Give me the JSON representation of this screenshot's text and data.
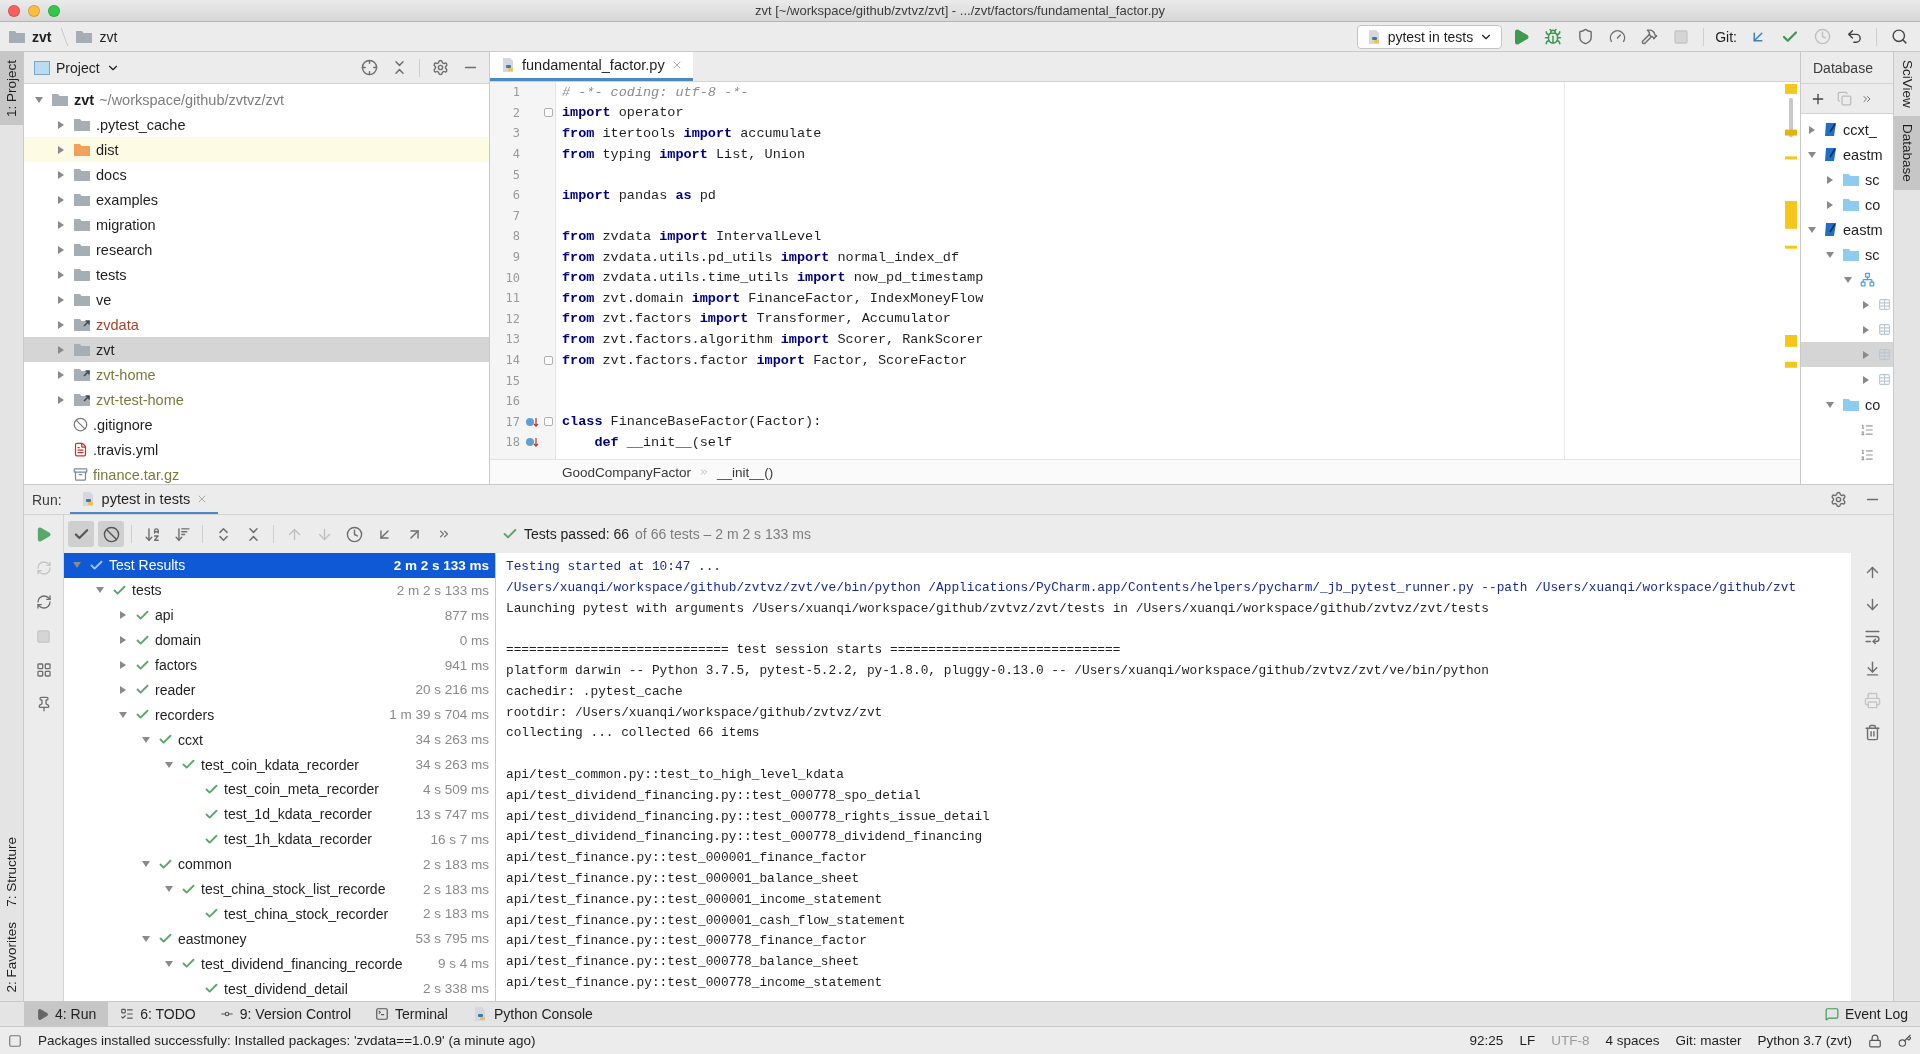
{
  "window": {
    "title": "zvt [~/workspace/github/zvtvz/zvt] - .../zvt/factors/fundamental_factor.py"
  },
  "breadcrumb": [
    "zvt",
    "zvt"
  ],
  "toolbar": {
    "run_config": "pytest in tests",
    "git_label": "Git:"
  },
  "left_strip": [
    {
      "label": "1: Project",
      "selected": true
    },
    {
      "label": "7: Structure",
      "selected": false
    },
    {
      "label": "2: Favorites",
      "selected": false
    }
  ],
  "right_strip": [
    {
      "label": "SciView",
      "selected": false
    },
    {
      "label": "Database",
      "selected": true
    }
  ],
  "project": {
    "header": "Project",
    "root": {
      "name": "zvt",
      "path": "~/workspace/github/zvtvz/zvt",
      "expanded": true
    },
    "items": [
      {
        "name": ".pytest_cache",
        "kind": "folder",
        "color": "#1f1f1f",
        "selected": false
      },
      {
        "name": "dist",
        "kind": "excluded",
        "color": "#1f1f1f",
        "selected": false
      },
      {
        "name": "docs",
        "kind": "folder",
        "color": "#1f1f1f",
        "selected": false
      },
      {
        "name": "examples",
        "kind": "folder",
        "color": "#1f1f1f",
        "selected": false
      },
      {
        "name": "migration",
        "kind": "folder",
        "color": "#1f1f1f",
        "selected": false
      },
      {
        "name": "research",
        "kind": "folder",
        "color": "#1f1f1f",
        "selected": false
      },
      {
        "name": "tests",
        "kind": "folder",
        "color": "#1f1f1f",
        "selected": false
      },
      {
        "name": "ve",
        "kind": "folder",
        "color": "#1f1f1f",
        "selected": false
      },
      {
        "name": "zvdata",
        "kind": "link",
        "color": "#a6442a",
        "selected": false
      },
      {
        "name": "zvt",
        "kind": "folder",
        "color": "#1f1f1f",
        "selected": true
      },
      {
        "name": "zvt-home",
        "kind": "link",
        "color": "#7b7a3c",
        "selected": false
      },
      {
        "name": "zvt-test-home",
        "kind": "link",
        "color": "#7b7a3c",
        "selected": false
      },
      {
        "name": ".gitignore",
        "kind": "ignore-file",
        "color": "#1f1f1f",
        "selected": false
      },
      {
        "name": ".travis.yml",
        "kind": "yaml",
        "color": "#1f1f1f",
        "selected": false
      },
      {
        "name": "finance.tar.gz",
        "kind": "archive",
        "color": "#7b7a3c",
        "selected": false
      }
    ]
  },
  "editor": {
    "tab": "fundamental_factor.py",
    "lines": [
      {
        "n": "1",
        "kind": "comment",
        "text": "# -*- coding: utf-8 -*-",
        "fold": false,
        "overridden": false
      },
      {
        "n": "2",
        "kind": "code",
        "text": "**import** operator",
        "fold": true,
        "overridden": false
      },
      {
        "n": "3",
        "kind": "code",
        "text": "**from** itertools **import** accumulate",
        "fold": false,
        "overridden": false
      },
      {
        "n": "4",
        "kind": "code",
        "text": "**from** typing **import** List, Union",
        "fold": false,
        "overridden": false
      },
      {
        "n": "5",
        "kind": "blank",
        "fold": false,
        "overridden": false
      },
      {
        "n": "6",
        "kind": "code",
        "text": "**import** pandas **as** pd",
        "fold": false,
        "overridden": false
      },
      {
        "n": "7",
        "kind": "blank",
        "fold": false,
        "overridden": false
      },
      {
        "n": "8",
        "kind": "code",
        "text": "**from** zvdata **import** IntervalLevel",
        "fold": false,
        "overridden": false
      },
      {
        "n": "9",
        "kind": "code",
        "text": "**from** zvdata.utils.pd_utils **import** normal_index_df",
        "fold": false,
        "overridden": false
      },
      {
        "n": "10",
        "kind": "code",
        "text": "**from** zvdata.utils.time_utils **import** now_pd_timestamp",
        "fold": false,
        "overridden": false
      },
      {
        "n": "11",
        "kind": "code",
        "text": "**from** zvt.domain **import** FinanceFactor, IndexMoneyFlow",
        "fold": false,
        "overridden": false
      },
      {
        "n": "12",
        "kind": "code",
        "text": "**from** zvt.factors **import** Transformer, Accumulator",
        "fold": false,
        "overridden": false
      },
      {
        "n": "13",
        "kind": "code",
        "text": "**from** zvt.factors.algorithm **import** Scorer, RankScorer",
        "fold": false,
        "overridden": false
      },
      {
        "n": "14",
        "kind": "code",
        "text": "**from** zvt.factors.factor **import** Factor, ScoreFactor",
        "fold": true,
        "overridden": false
      },
      {
        "n": "15",
        "kind": "blank",
        "fold": false,
        "overridden": false
      },
      {
        "n": "16",
        "kind": "blank",
        "fold": false,
        "overridden": false
      },
      {
        "n": "17",
        "kind": "code",
        "text": "**class** FinanceBaseFactor(Factor):",
        "fold": true,
        "overridden": true
      },
      {
        "n": "18",
        "kind": "code",
        "text": "    **def** __init__(self",
        "fold": false,
        "overridden": true
      }
    ],
    "breadcrumb": [
      "GoodCompanyFactor",
      "__init__()"
    ]
  },
  "database": {
    "header": "Database",
    "items": [
      {
        "name": "ccxt_",
        "kind": "database",
        "expanded": false,
        "selected": false
      },
      {
        "name": "eastm",
        "kind": "database",
        "expanded": true,
        "selected": false,
        "children": [
          {
            "name": "sc",
            "kind": "folder",
            "expanded": false,
            "selected": false
          },
          {
            "name": "co",
            "kind": "folder",
            "expanded": false,
            "selected": false
          }
        ]
      },
      {
        "name": "eastm",
        "kind": "database",
        "expanded": true,
        "selected": false,
        "children": [
          {
            "name": "sc",
            "kind": "folder",
            "expanded": true,
            "selected": false,
            "children": [
              {
                "kind": "schema",
                "expanded": true,
                "selected": false,
                "children": [
                  {
                    "kind": "table",
                    "expanded": false,
                    "selected": false
                  },
                  {
                    "kind": "table",
                    "expanded": false,
                    "selected": false
                  },
                  {
                    "kind": "table",
                    "expanded": false,
                    "selected": true
                  },
                  {
                    "kind": "table",
                    "expanded": false,
                    "selected": false
                  }
                ]
              }
            ]
          },
          {
            "name": "co",
            "kind": "folder",
            "expanded": true,
            "selected": false,
            "children": [
              {
                "kind": "index",
                "selected": false
              },
              {
                "kind": "index",
                "selected": false
              }
            ]
          }
        ]
      }
    ]
  },
  "run": {
    "label": "Run:",
    "tab": "pytest in tests",
    "summary": "Tests passed: 66",
    "summary_detail": "of 66 tests – 2 m 2 s 133 ms",
    "toggles": [
      {
        "kind": "show-passed",
        "on": true
      },
      {
        "kind": "show-ignored",
        "on": true
      }
    ],
    "tests": [
      {
        "name": "Test Results",
        "time": "2 m 2 s 133 ms",
        "passed": true,
        "expanded": true,
        "selected": true,
        "children": [
          {
            "name": "tests",
            "time": "2 m 2 s 133 ms",
            "passed": true,
            "expanded": true,
            "selected": false,
            "children": [
              {
                "name": "api",
                "time": "877 ms",
                "passed": true,
                "expanded": false,
                "selected": false
              },
              {
                "name": "domain",
                "time": "0 ms",
                "passed": true,
                "expanded": false,
                "selected": false
              },
              {
                "name": "factors",
                "time": "941 ms",
                "passed": true,
                "expanded": false,
                "selected": false
              },
              {
                "name": "reader",
                "time": "20 s 216 ms",
                "passed": true,
                "expanded": false,
                "selected": false
              },
              {
                "name": "recorders",
                "time": "1 m 39 s 704 ms",
                "passed": true,
                "expanded": true,
                "selected": false,
                "children": [
                  {
                    "name": "ccxt",
                    "time": "34 s 263 ms",
                    "passed": true,
                    "expanded": true,
                    "selected": false,
                    "children": [
                      {
                        "name": "test_coin_kdata_recorder",
                        "time": "34 s 263 ms",
                        "passed": true,
                        "expanded": true,
                        "selected": false,
                        "children": [
                          {
                            "name": "test_coin_meta_recorder",
                            "time": "4 s 509 ms",
                            "passed": true,
                            "selected": false
                          },
                          {
                            "name": "test_1d_kdata_recorder",
                            "time": "13 s 747 ms",
                            "passed": true,
                            "selected": false
                          },
                          {
                            "name": "test_1h_kdata_recorder",
                            "time": "16 s 7 ms",
                            "passed": true,
                            "selected": false
                          }
                        ]
                      }
                    ]
                  },
                  {
                    "name": "common",
                    "time": "2 s 183 ms",
                    "passed": true,
                    "expanded": true,
                    "selected": false,
                    "children": [
                      {
                        "name": "test_china_stock_list_recorde",
                        "time": "2 s 183 ms",
                        "passed": true,
                        "expanded": true,
                        "selected": false,
                        "children": [
                          {
                            "name": "test_china_stock_recorder",
                            "time": "2 s 183 ms",
                            "passed": true,
                            "selected": false
                          }
                        ]
                      }
                    ]
                  },
                  {
                    "name": "eastmoney",
                    "time": "53 s 795 ms",
                    "passed": true,
                    "expanded": true,
                    "selected": false,
                    "children": [
                      {
                        "name": "test_dividend_financing_recorde",
                        "time": "9 s 4 ms",
                        "passed": true,
                        "expanded": true,
                        "selected": false,
                        "children": [
                          {
                            "name": "test_dividend_detail",
                            "time": "2 s 338 ms",
                            "passed": true,
                            "selected": false
                          }
                        ]
                      }
                    ]
                  }
                ]
              }
            ]
          }
        ]
      }
    ],
    "console": [
      {
        "kind": "info",
        "text": "Testing started at 10:47 ..."
      },
      {
        "kind": "info",
        "text": "/Users/xuanqi/workspace/github/zvtvz/zvt/ve/bin/python /Applications/PyCharm.app/Contents/helpers/pycharm/_jb_pytest_runner.py --path /Users/xuanqi/workspace/github/zvt"
      },
      {
        "kind": "output",
        "text": "Launching pytest with arguments /Users/xuanqi/workspace/github/zvtvz/zvt/tests in /Users/xuanqi/workspace/github/zvtvz/zvt/tests"
      },
      {
        "kind": "blank"
      },
      {
        "kind": "output",
        "text": "============================= test session starts =============================="
      },
      {
        "kind": "output",
        "text": "platform darwin -- Python 3.7.5, pytest-5.2.2, py-1.8.0, pluggy-0.13.0 -- /Users/xuanqi/workspace/github/zvtvz/zvt/ve/bin/python"
      },
      {
        "kind": "output",
        "text": "cachedir: .pytest_cache"
      },
      {
        "kind": "output",
        "text": "rootdir: /Users/xuanqi/workspace/github/zvtvz/zvt"
      },
      {
        "kind": "output",
        "text": "collecting ... collected 66 items"
      },
      {
        "kind": "blank"
      },
      {
        "kind": "output",
        "text": "api/test_common.py::test_to_high_level_kdata"
      },
      {
        "kind": "output",
        "text": "api/test_dividend_financing.py::test_000778_spo_detial"
      },
      {
        "kind": "output",
        "text": "api/test_dividend_financing.py::test_000778_rights_issue_detail"
      },
      {
        "kind": "output",
        "text": "api/test_dividend_financing.py::test_000778_dividend_financing"
      },
      {
        "kind": "output",
        "text": "api/test_finance.py::test_000001_finance_factor"
      },
      {
        "kind": "output",
        "text": "api/test_finance.py::test_000001_balance_sheet"
      },
      {
        "kind": "output",
        "text": "api/test_finance.py::test_000001_income_statement"
      },
      {
        "kind": "output",
        "text": "api/test_finance.py::test_000001_cash_flow_statement"
      },
      {
        "kind": "output",
        "text": "api/test_finance.py::test_000778_finance_factor"
      },
      {
        "kind": "output",
        "text": "api/test_finance.py::test_000778_balance_sheet"
      },
      {
        "kind": "output",
        "text": "api/test_finance.py::test_000778_income_statement"
      }
    ]
  },
  "bottom_tabs": [
    {
      "label": "4: Run",
      "kind": "run",
      "selected": true
    },
    {
      "label": "6: TODO",
      "kind": "todo",
      "selected": false
    },
    {
      "label": "9: Version Control",
      "kind": "vcs",
      "selected": false
    },
    {
      "label": "Terminal",
      "kind": "terminal",
      "selected": false
    },
    {
      "label": "Python Console",
      "kind": "console",
      "selected": false
    }
  ],
  "event_log": "Event Log",
  "status_bar": {
    "message": "Packages installed successfully: Installed packages: 'zvdata==1.0.9' (a minute ago)",
    "items": [
      {
        "text": "92:25",
        "disabled": false
      },
      {
        "text": "LF",
        "disabled": false
      },
      {
        "text": "UTF-8",
        "disabled": true
      },
      {
        "text": "4 spaces",
        "disabled": false
      },
      {
        "text": "Git: master",
        "disabled": false
      },
      {
        "text": "Python 3.7 (zvt)",
        "disabled": false
      }
    ]
  }
}
